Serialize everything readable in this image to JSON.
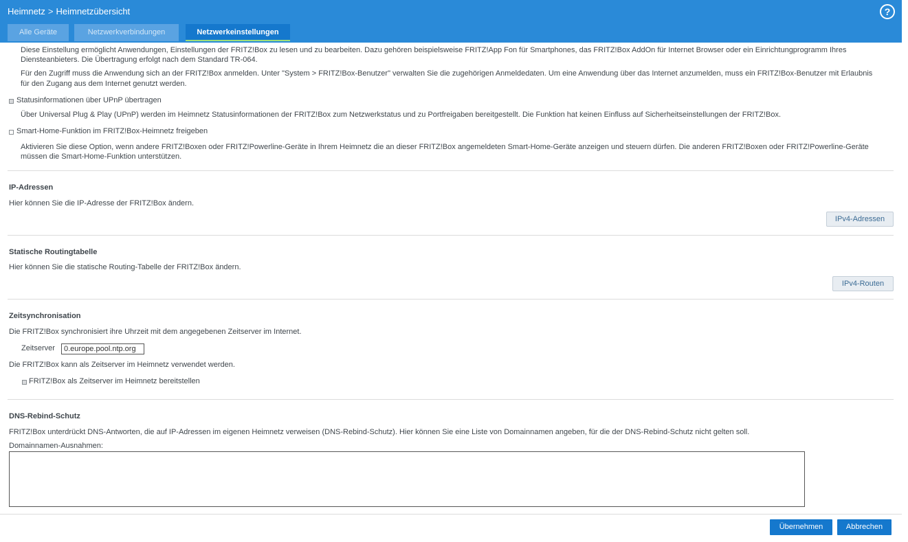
{
  "header": {
    "breadcrumb_parent": "Heimnetz",
    "breadcrumb_separator": ">",
    "breadcrumb_current": "Heimnetzübersicht",
    "help_label": "?",
    "bg_color": "#2a8ad8"
  },
  "tabs": [
    {
      "label": "Alle Geräte",
      "active": false
    },
    {
      "label": "Netzwerkverbindungen",
      "active": false
    },
    {
      "label": "Netzwerkeinstellungen",
      "active": true
    }
  ],
  "app_access": {
    "description_1": "Diese Einstellung ermöglicht Anwendungen, Einstellungen der FRITZ!Box zu lesen und zu bearbeiten. Dazu gehören beispielsweise FRITZ!App Fon für Smartphones, das FRITZ!Box AddOn für Internet Browser oder ein Einrichtungprogramm Ihres",
    "description_1b": "Diensteanbieters. Die Übertragung erfolgt nach dem Standard TR-064.",
    "description_2": "Für den Zugriff muss die Anwendung sich an der FRITZ!Box anmelden. Unter \"System > FRITZ!Box-Benutzer\" verwalten Sie die zugehörigen Anmeldedaten. Um eine Anwendung über das Internet anzumelden, muss ein FRITZ!Box-Benutzer mit Erlaubnis",
    "description_2b": "für den Zugang aus dem Internet genutzt werden."
  },
  "upnp": {
    "label": "Statusinformationen über UPnP übertragen",
    "checked": true,
    "description": "Über Universal Plug & Play (UPnP) werden im Heimnetz Statusinformationen der FRITZ!Box zum Netzwerkstatus und zu Portfreigaben bereitgestellt. Die Funktion hat keinen Einfluss auf Sicherheitseinstellungen der FRITZ!Box."
  },
  "smarthome": {
    "label": "Smart-Home-Funktion im FRITZ!Box-Heimnetz freigeben",
    "checked": false,
    "description_1": "Aktivieren Sie diese Option, wenn andere FRITZ!Boxen oder FRITZ!Powerline-Geräte in Ihrem Heimnetz die an dieser FRITZ!Box angemeldeten Smart-Home-Geräte anzeigen und steuern dürfen. Die anderen FRITZ!Boxen oder FRITZ!Powerline-Geräte",
    "description_2": "müssen die Smart-Home-Funktion unterstützen."
  },
  "ip": {
    "title": "IP-Adressen",
    "description": "Hier können Sie die IP-Adresse der FRITZ!Box ändern.",
    "button": "IPv4-Adressen"
  },
  "routing": {
    "title": "Statische Routingtabelle",
    "description": "Hier können Sie die statische Routing-Tabelle der FRITZ!Box ändern.",
    "button": "IPv4-Routen"
  },
  "time": {
    "title": "Zeitsynchronisation",
    "description": "Die FRITZ!Box synchronisiert ihre Uhrzeit mit dem angegebenen Zeitserver im Internet.",
    "server_label": "Zeitserver",
    "server_value": "0.europe.pool.ntp.org",
    "description_2": "Die FRITZ!Box kann als Zeitserver im Heimnetz verwendet werden.",
    "option_label": "FRITZ!Box als Zeitserver im Heimnetz bereitstellen",
    "option_checked": true
  },
  "dns": {
    "title": "DNS-Rebind-Schutz",
    "description": "FRITZ!Box unterdrückt DNS-Antworten, die auf IP-Adressen im eigenen Heimnetz verweisen (DNS-Rebind-Schutz). Hier können Sie eine Liste von Domainnamen angeben, für die der DNS-Rebind-Schutz nicht gelten soll.",
    "exceptions_label": "Domainnamen-Ausnahmen:",
    "exceptions_value": ""
  },
  "footer": {
    "apply": "Übernehmen",
    "cancel": "Abbrechen"
  }
}
